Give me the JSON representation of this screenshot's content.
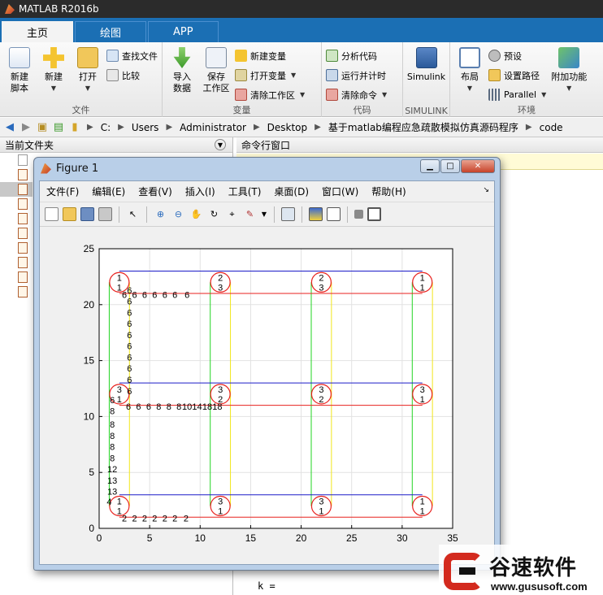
{
  "app": {
    "title": "MATLAB R2016b"
  },
  "tabs": [
    {
      "label": "主页",
      "active": true
    },
    {
      "label": "绘图",
      "active": false
    },
    {
      "label": "APP",
      "active": false
    }
  ],
  "ribbon": {
    "file_group": {
      "label": "文件",
      "new_script": "新建\n脚本",
      "new": "新建",
      "open": "打开",
      "find_files": "查找文件",
      "compare": "比较"
    },
    "variable_group": {
      "label": "变量",
      "import": "导入\n数据",
      "save_ws": "保存\n工作区",
      "new_var": "新建变量",
      "open_var": "打开变量",
      "clear_ws": "清除工作区"
    },
    "code_group": {
      "label": "代码",
      "analyze": "分析代码",
      "run_time": "运行并计时",
      "clear_cmd": "清除命令"
    },
    "simulink_group": {
      "label": "SIMULINK",
      "simulink": "Simulink"
    },
    "env_group": {
      "label": "环境",
      "layout": "布局",
      "prefs": "预设",
      "set_path": "设置路径",
      "parallel": "Parallel",
      "addons": "附加功能"
    }
  },
  "address": {
    "crumbs": [
      "C:",
      "Users",
      "Administrator",
      "Desktop",
      "基于matlab编程应急疏散模拟仿真源码程序",
      "code"
    ]
  },
  "left_panel": {
    "title": "当前文件夹"
  },
  "right_panel": {
    "title": "命令行窗口",
    "prompt_text": "k ="
  },
  "figure": {
    "title": "Figure 1",
    "menu": [
      "文件(F)",
      "编辑(E)",
      "查看(V)",
      "插入(I)",
      "工具(T)",
      "桌面(D)",
      "窗口(W)",
      "帮助(H)"
    ]
  },
  "chart_data": {
    "type": "scatter",
    "xlim": [
      0,
      35
    ],
    "ylim": [
      0,
      25
    ],
    "xticks": [
      0,
      5,
      10,
      15,
      20,
      25,
      30,
      35
    ],
    "yticks": [
      0,
      5,
      10,
      15,
      20,
      25
    ],
    "grid": true,
    "colors": {
      "red": "#e8221f",
      "blue": "#1b1bc8",
      "green": "#22d422",
      "yellow": "#f2e61a",
      "axes": "#000000"
    },
    "circles": [
      {
        "x": 2,
        "y": 22,
        "top": "1",
        "bottom": "1"
      },
      {
        "x": 12,
        "y": 22,
        "top": "2",
        "bottom": "3"
      },
      {
        "x": 22,
        "y": 22,
        "top": "2",
        "bottom": "3"
      },
      {
        "x": 32,
        "y": 22,
        "top": "1",
        "bottom": "1"
      },
      {
        "x": 2,
        "y": 12,
        "top": "3",
        "bottom": "1"
      },
      {
        "x": 12,
        "y": 12,
        "top": "3",
        "bottom": "2"
      },
      {
        "x": 22,
        "y": 12,
        "top": "3",
        "bottom": "2"
      },
      {
        "x": 32,
        "y": 12,
        "top": "3",
        "bottom": "1"
      },
      {
        "x": 2,
        "y": 2,
        "top": "1",
        "bottom": "1"
      },
      {
        "x": 12,
        "y": 2,
        "top": "3",
        "bottom": "1"
      },
      {
        "x": 22,
        "y": 2,
        "top": "3",
        "bottom": "1"
      },
      {
        "x": 32,
        "y": 2,
        "top": "1",
        "bottom": "1"
      }
    ],
    "h_lines": [
      {
        "y": 23,
        "x1": 2,
        "x2": 32,
        "color": "blue"
      },
      {
        "y": 21,
        "x1": 2,
        "x2": 32,
        "color": "red"
      },
      {
        "y": 13,
        "x1": 2,
        "x2": 32,
        "color": "blue"
      },
      {
        "y": 11,
        "x1": 2,
        "x2": 32,
        "color": "red"
      },
      {
        "y": 3,
        "x1": 2,
        "x2": 32,
        "color": "blue"
      },
      {
        "y": 1,
        "x1": 2,
        "x2": 32,
        "color": "red"
      }
    ],
    "v_lines": [
      {
        "x": 1,
        "y1": 2,
        "y2": 22,
        "color": "green"
      },
      {
        "x": 3,
        "y1": 2,
        "y2": 22,
        "color": "yellow"
      },
      {
        "x": 11,
        "y1": 2,
        "y2": 22,
        "color": "green"
      },
      {
        "x": 13,
        "y1": 2,
        "y2": 22,
        "color": "yellow"
      },
      {
        "x": 21,
        "y1": 2,
        "y2": 22,
        "color": "green"
      },
      {
        "x": 23,
        "y1": 2,
        "y2": 22,
        "color": "yellow"
      },
      {
        "x": 31,
        "y1": 2,
        "y2": 22,
        "color": "green"
      },
      {
        "x": 33,
        "y1": 2,
        "y2": 22,
        "color": "yellow"
      }
    ],
    "labels": [
      {
        "x": 3.0,
        "y": 21.3,
        "text": "6"
      },
      {
        "x": 2.5,
        "y": 20.9,
        "text": "6"
      },
      {
        "x": 3.5,
        "y": 20.9,
        "text": "6"
      },
      {
        "x": 4.5,
        "y": 20.9,
        "text": "6"
      },
      {
        "x": 5.5,
        "y": 20.9,
        "text": "6"
      },
      {
        "x": 6.5,
        "y": 20.9,
        "text": "6"
      },
      {
        "x": 7.5,
        "y": 20.9,
        "text": "6"
      },
      {
        "x": 8.7,
        "y": 20.9,
        "text": "6"
      },
      {
        "x": 3.0,
        "y": 20.3,
        "text": "6"
      },
      {
        "x": 3.0,
        "y": 19.3,
        "text": "6"
      },
      {
        "x": 3.0,
        "y": 18.3,
        "text": "6"
      },
      {
        "x": 3.0,
        "y": 17.3,
        "text": "6"
      },
      {
        "x": 3.0,
        "y": 16.3,
        "text": "6"
      },
      {
        "x": 3.0,
        "y": 15.3,
        "text": "6"
      },
      {
        "x": 3.0,
        "y": 14.3,
        "text": "6"
      },
      {
        "x": 3.0,
        "y": 13.3,
        "text": "6"
      },
      {
        "x": 3.0,
        "y": 12.3,
        "text": "6"
      },
      {
        "x": 1.3,
        "y": 11.5,
        "text": "6"
      },
      {
        "x": 2.9,
        "y": 10.9,
        "text": "6"
      },
      {
        "x": 3.9,
        "y": 10.9,
        "text": "6"
      },
      {
        "x": 4.9,
        "y": 10.9,
        "text": "6"
      },
      {
        "x": 5.9,
        "y": 10.9,
        "text": "8"
      },
      {
        "x": 6.9,
        "y": 10.9,
        "text": "8"
      },
      {
        "x": 7.9,
        "y": 10.9,
        "text": "8"
      },
      {
        "x": 8.7,
        "y": 10.9,
        "text": "10"
      },
      {
        "x": 9.7,
        "y": 10.9,
        "text": "14"
      },
      {
        "x": 10.7,
        "y": 10.9,
        "text": "18"
      },
      {
        "x": 11.7,
        "y": 10.9,
        "text": "18"
      },
      {
        "x": 1.3,
        "y": 10.5,
        "text": "8"
      },
      {
        "x": 1.3,
        "y": 9.3,
        "text": "8"
      },
      {
        "x": 1.3,
        "y": 8.3,
        "text": "8"
      },
      {
        "x": 1.3,
        "y": 7.3,
        "text": "8"
      },
      {
        "x": 1.3,
        "y": 6.3,
        "text": "8"
      },
      {
        "x": 1.3,
        "y": 5.3,
        "text": "12"
      },
      {
        "x": 1.3,
        "y": 4.3,
        "text": "13"
      },
      {
        "x": 1.3,
        "y": 3.3,
        "text": "13"
      },
      {
        "x": 1.0,
        "y": 2.4,
        "text": "4"
      },
      {
        "x": 2.5,
        "y": 0.9,
        "text": "2"
      },
      {
        "x": 3.5,
        "y": 0.9,
        "text": "2"
      },
      {
        "x": 4.5,
        "y": 0.9,
        "text": "2"
      },
      {
        "x": 5.5,
        "y": 0.9,
        "text": "2"
      },
      {
        "x": 6.5,
        "y": 0.9,
        "text": "2"
      },
      {
        "x": 7.5,
        "y": 0.9,
        "text": "2"
      },
      {
        "x": 8.6,
        "y": 0.9,
        "text": "2"
      }
    ]
  },
  "watermark": {
    "name": "谷速软件",
    "url": "www.gususoft.com"
  }
}
